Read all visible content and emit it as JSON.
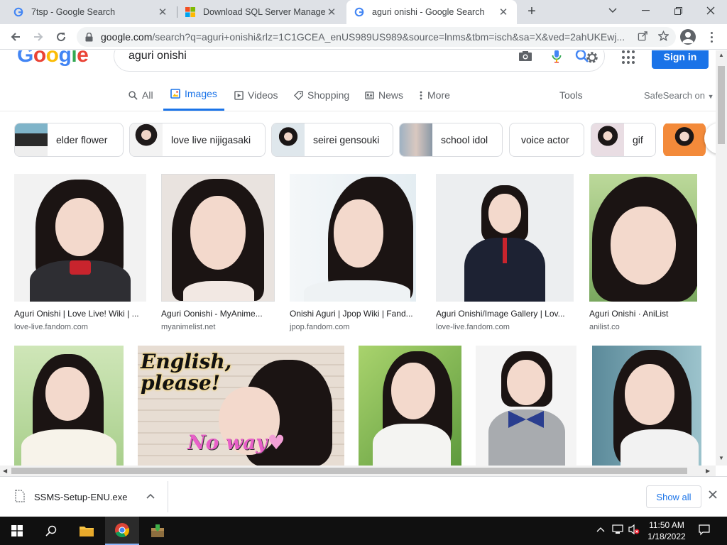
{
  "browser": {
    "tabs": [
      {
        "title": "7tsp - Google Search",
        "favicon": "google-icon"
      },
      {
        "title": "Download SQL Server Manageme",
        "favicon": "microsoft-icon"
      },
      {
        "title": "aguri onishi - Google Search",
        "favicon": "google-icon",
        "active": true
      }
    ],
    "url_host": "google.com",
    "url_path": "/search?q=aguri+onishi&rlz=1C1GCEA_enUS989US989&source=lnms&tbm=isch&sa=X&ved=2ahUKEwj..."
  },
  "search": {
    "logo": "Google",
    "query": "aguri onishi",
    "signin_label": "Sign in"
  },
  "tabs": [
    {
      "label": "All",
      "icon": "search-icon"
    },
    {
      "label": "Images",
      "icon": "image-icon",
      "active": true
    },
    {
      "label": "Videos",
      "icon": "video-icon"
    },
    {
      "label": "Shopping",
      "icon": "tag-icon"
    },
    {
      "label": "News",
      "icon": "news-icon"
    },
    {
      "label": "More",
      "icon": "more-vert-icon"
    }
  ],
  "tools_label": "Tools",
  "safesearch_label": "SafeSearch on",
  "chips": [
    "elder flower",
    "love live nijigasaki",
    "seirei gensouki",
    "school idol",
    "voice actor",
    "gif"
  ],
  "results_row1": [
    {
      "caption": "Aguri Onishi | Love Live! Wiki | ...",
      "source": "love-live.fandom.com"
    },
    {
      "caption": "Aguri Oonishi - MyAnime...",
      "source": "myanimelist.net"
    },
    {
      "caption": "Onishi Aguri | Jpop Wiki | Fand...",
      "source": "jpop.fandom.com"
    },
    {
      "caption": "Aguri Onishi/Image Gallery | Lov...",
      "source": "love-live.fandom.com"
    },
    {
      "caption": "Aguri Onishi · AniList",
      "source": "anilist.co"
    }
  ],
  "image_overlay": {
    "line1": "English,",
    "line2": "please!",
    "line3": "No way"
  },
  "downloads": {
    "filename": "SSMS-Setup-ENU.exe",
    "show_all": "Show all"
  },
  "taskbar": {
    "time": "11:50 AM",
    "date": "1/18/2022"
  },
  "colors": {
    "accent": "#1a73e8",
    "tabstrip": "#dee1e6",
    "taskbar": "#101010"
  }
}
